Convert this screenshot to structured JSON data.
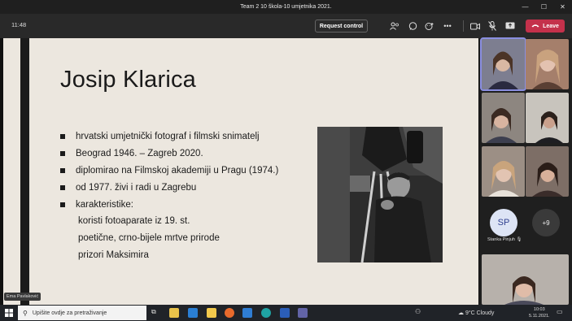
{
  "window": {
    "title": "Team 2 10 škola-10 umjetnika 2021."
  },
  "toolbar": {
    "time": "11:48",
    "request_control_label": "Request control",
    "leave_label": "Leave"
  },
  "slide": {
    "title": "Josip Klarica",
    "bullets": [
      "hrvatski umjetnički fotograf i filmski snimatelj",
      "Beograd 1946. – Zagreb 2020.",
      "diplomirao na Filmskoj akademiji u Pragu (1974.)",
      "od 1977. živi i radi u Zagrebu",
      "karakteristike:"
    ],
    "subitems": [
      "koristi fotoaparate iz 19. st.",
      "poetične, crno-bijele mrtve prirode",
      "prizori Maksimira"
    ]
  },
  "presenter_tag": "Ema Pavlaković",
  "participants": {
    "avatar_initials": "SP",
    "avatar_name": "Stanka Pinjuh",
    "more_count": "+9"
  },
  "taskbar": {
    "search_placeholder": "Upišite ovdje za pretraživanje",
    "weather": "9°C  Cloudy",
    "time": "10:03",
    "date": "5.11.2021."
  },
  "colors": {
    "leave": "#c4314b",
    "slide_bg": "#ece7df",
    "active_outline": "#8a8ee0"
  }
}
